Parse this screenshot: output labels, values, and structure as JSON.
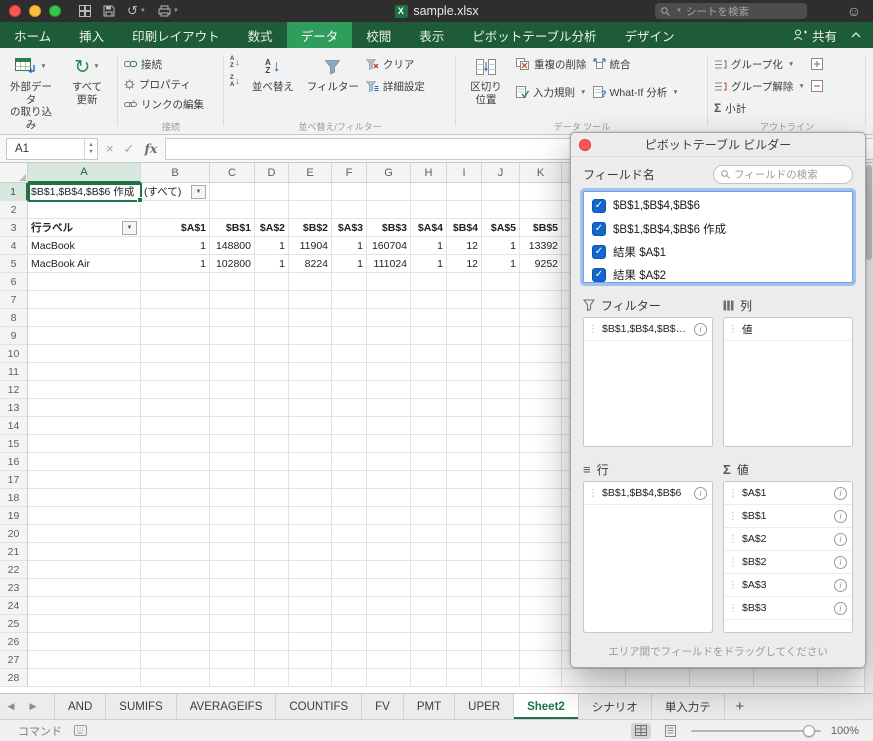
{
  "titlebar": {
    "title": "sample.xlsx",
    "search_placeholder": "シートを検索"
  },
  "tabbar": {
    "tabs": [
      {
        "label": "ホーム",
        "active": false
      },
      {
        "label": "挿入",
        "active": false
      },
      {
        "label": "印刷レイアウト",
        "active": false
      },
      {
        "label": "数式",
        "active": false
      },
      {
        "label": "データ",
        "active": true
      },
      {
        "label": "校閲",
        "active": false
      },
      {
        "label": "表示",
        "active": false
      },
      {
        "label": "ピボットテーブル分析",
        "active": false
      },
      {
        "label": "デザイン",
        "active": false
      }
    ],
    "share_label": "共有"
  },
  "ribbon": {
    "external": {
      "line1": "外部データ",
      "line2": "の取り込み"
    },
    "refresh": {
      "line1": "すべて",
      "line2": "更新"
    },
    "connect": {
      "label": "接続",
      "items": [
        "接続",
        "プロパティ",
        "リンクの編集"
      ]
    },
    "sortfilter": {
      "label": "並べ替え/フィルター",
      "sort": "並べ替え",
      "filter": "フィルター",
      "clear": "クリア",
      "advanced": "詳細設定"
    },
    "tools": {
      "label": "データ ツール",
      "ttc1": "区切り",
      "ttc2": "位置",
      "dedup": "重複の削除",
      "validation": "入力規則",
      "consolidate": "統合",
      "whatif": "What-If 分析"
    },
    "outline": {
      "label": "アウトライン",
      "group": "グループ化",
      "ungroup": "グループ解除",
      "subtotal": "小計"
    }
  },
  "formula": {
    "name_box": "A1",
    "fx_label": "fx"
  },
  "grid": {
    "columns": [
      {
        "letter": "A",
        "width": 113,
        "selected": true
      },
      {
        "letter": "B",
        "width": 69
      },
      {
        "letter": "C",
        "width": 45
      },
      {
        "letter": "D",
        "width": 34
      },
      {
        "letter": "E",
        "width": 43
      },
      {
        "letter": "F",
        "width": 35
      },
      {
        "letter": "G",
        "width": 44
      },
      {
        "letter": "H",
        "width": 36
      },
      {
        "letter": "I",
        "width": 35
      },
      {
        "letter": "J",
        "width": 38
      },
      {
        "letter": "K",
        "width": 42
      }
    ],
    "row_count": 28,
    "selected_row": 1,
    "cells": [
      {
        "r": 1,
        "c": "A",
        "v": "$B$1,$B$4,$B$6 作成"
      },
      {
        "r": 1,
        "c": "B",
        "v": "(すべて)",
        "combo": true
      },
      {
        "r": 3,
        "c": "A",
        "v": "行ラベル",
        "bold": true,
        "filter": true
      },
      {
        "r": 3,
        "c": "B",
        "v": "$A$1",
        "bold": true,
        "num": true
      },
      {
        "r": 3,
        "c": "C",
        "v": "$B$1",
        "bold": true,
        "num": true
      },
      {
        "r": 3,
        "c": "D",
        "v": "$A$2",
        "bold": true,
        "num": true
      },
      {
        "r": 3,
        "c": "E",
        "v": "$B$2",
        "bold": true,
        "num": true
      },
      {
        "r": 3,
        "c": "F",
        "v": "$A$3",
        "bold": true,
        "num": true
      },
      {
        "r": 3,
        "c": "G",
        "v": "$B$3",
        "bold": true,
        "num": true
      },
      {
        "r": 3,
        "c": "H",
        "v": "$A$4",
        "bold": true,
        "num": true
      },
      {
        "r": 3,
        "c": "I",
        "v": "$B$4",
        "bold": true,
        "num": true
      },
      {
        "r": 3,
        "c": "J",
        "v": "$A$5",
        "bold": true,
        "num": true
      },
      {
        "r": 3,
        "c": "K",
        "v": "$B$5",
        "bold": true,
        "num": true
      },
      {
        "r": 4,
        "c": "A",
        "v": "MacBook"
      },
      {
        "r": 4,
        "c": "B",
        "v": "1",
        "num": true
      },
      {
        "r": 4,
        "c": "C",
        "v": "148800",
        "num": true
      },
      {
        "r": 4,
        "c": "D",
        "v": "1",
        "num": true
      },
      {
        "r": 4,
        "c": "E",
        "v": "11904",
        "num": true
      },
      {
        "r": 4,
        "c": "F",
        "v": "1",
        "num": true
      },
      {
        "r": 4,
        "c": "G",
        "v": "160704",
        "num": true
      },
      {
        "r": 4,
        "c": "H",
        "v": "1",
        "num": true
      },
      {
        "r": 4,
        "c": "I",
        "v": "12",
        "num": true
      },
      {
        "r": 4,
        "c": "J",
        "v": "1",
        "num": true
      },
      {
        "r": 4,
        "c": "K",
        "v": "13392",
        "num": true
      },
      {
        "r": 5,
        "c": "A",
        "v": "MacBook Air"
      },
      {
        "r": 5,
        "c": "B",
        "v": "1",
        "num": true
      },
      {
        "r": 5,
        "c": "C",
        "v": "102800",
        "num": true
      },
      {
        "r": 5,
        "c": "D",
        "v": "1",
        "num": true
      },
      {
        "r": 5,
        "c": "E",
        "v": "8224",
        "num": true
      },
      {
        "r": 5,
        "c": "F",
        "v": "1",
        "num": true
      },
      {
        "r": 5,
        "c": "G",
        "v": "111024",
        "num": true
      },
      {
        "r": 5,
        "c": "H",
        "v": "1",
        "num": true
      },
      {
        "r": 5,
        "c": "I",
        "v": "12",
        "num": true
      },
      {
        "r": 5,
        "c": "J",
        "v": "1",
        "num": true
      },
      {
        "r": 5,
        "c": "K",
        "v": "9252",
        "num": true
      }
    ]
  },
  "pivot": {
    "title": "ピボットテーブル ビルダー",
    "field_name_label": "フィールド名",
    "search_placeholder": "フィールドの検索",
    "fields": [
      {
        "label": "$B$1,$B$4,$B$6",
        "checked": true
      },
      {
        "label": "$B$1,$B$4,$B$6 作成",
        "checked": true
      },
      {
        "label": "結果 $A$1",
        "checked": true
      },
      {
        "label": "結果 $A$2",
        "checked": true
      }
    ],
    "areas": {
      "filter": {
        "label": "フィルター",
        "items": [
          {
            "label": "$B$1,$B$4,$B$6...",
            "info": true
          }
        ]
      },
      "columns": {
        "label": "列",
        "items": [
          {
            "label": "値",
            "info": false
          }
        ]
      },
      "rows": {
        "label": "行",
        "items": [
          {
            "label": "$B$1,$B$4,$B$6",
            "info": true
          }
        ]
      },
      "values": {
        "label": "値",
        "items": [
          {
            "label": "$A$1",
            "info": true
          },
          {
            "label": "$B$1",
            "info": true
          },
          {
            "label": "$A$2",
            "info": true
          },
          {
            "label": "$B$2",
            "info": true
          },
          {
            "label": "$A$3",
            "info": true
          },
          {
            "label": "$B$3",
            "info": true
          }
        ]
      }
    },
    "hint": "エリア間でフィールドをドラッグしてください"
  },
  "sheetbar": {
    "tabs": [
      {
        "label": "AND",
        "active": false
      },
      {
        "label": "SUMIFS",
        "active": false
      },
      {
        "label": "AVERAGEIFS",
        "active": false
      },
      {
        "label": "COUNTIFS",
        "active": false
      },
      {
        "label": "FV",
        "active": false
      },
      {
        "label": "PMT",
        "active": false
      },
      {
        "label": "UPER",
        "active": false
      },
      {
        "label": "Sheet2",
        "active": true
      },
      {
        "label": "シナリオ",
        "active": false
      },
      {
        "label": "単入力テ",
        "active": false
      }
    ],
    "add_label": "+"
  },
  "statusbar": {
    "mode": "コマンド",
    "zoom": "100%"
  }
}
